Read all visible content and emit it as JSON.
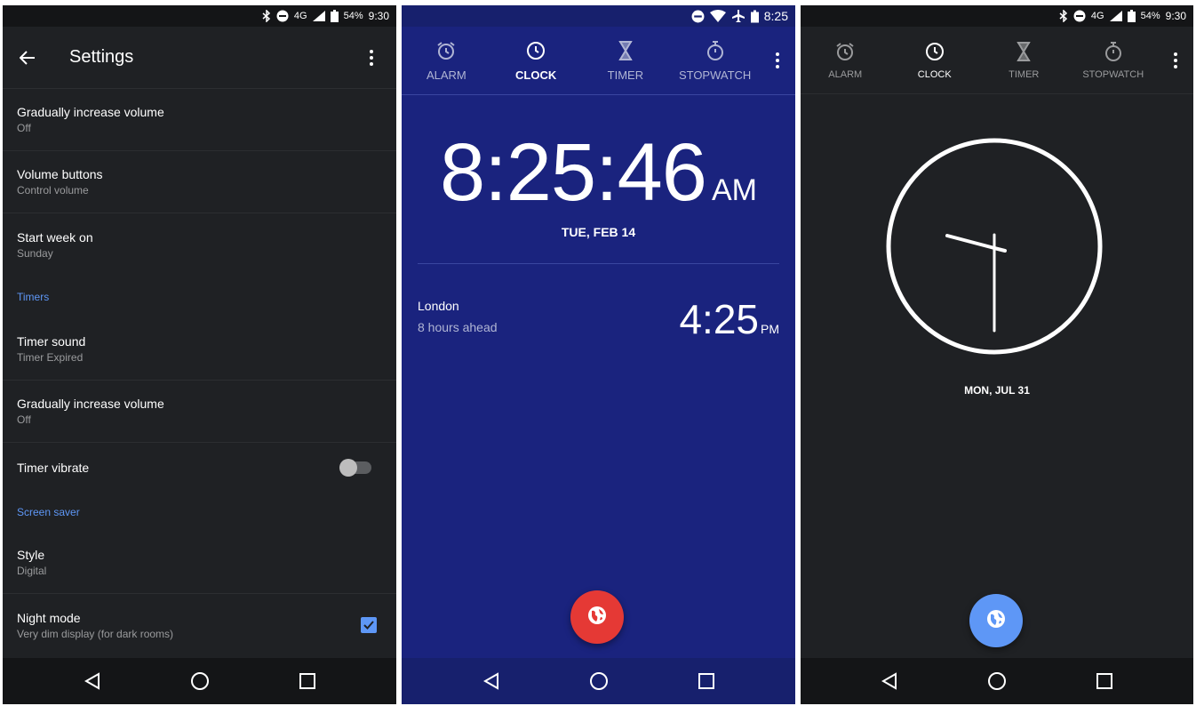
{
  "phone1": {
    "status": {
      "battery": "54%",
      "time": "9:30",
      "network": "4G"
    },
    "appbar": {
      "title": "Settings"
    },
    "items": [
      {
        "primary": "Gradually increase volume",
        "secondary": "Off"
      },
      {
        "primary": "Volume buttons",
        "secondary": "Control volume"
      },
      {
        "primary": "Start week on",
        "secondary": "Sunday"
      }
    ],
    "section_timers": "Timers",
    "timer_items": [
      {
        "primary": "Timer sound",
        "secondary": "Timer Expired"
      },
      {
        "primary": "Gradually increase volume",
        "secondary": "Off"
      }
    ],
    "timer_vibrate": {
      "label": "Timer vibrate",
      "checked": false
    },
    "section_screensaver": "Screen saver",
    "style": {
      "primary": "Style",
      "secondary": "Digital"
    },
    "night_mode": {
      "primary": "Night mode",
      "secondary": "Very dim display (for dark rooms)",
      "checked": true
    }
  },
  "phone2": {
    "status": {
      "time": "8:25"
    },
    "tabs": [
      {
        "label": "ALARM",
        "icon": "alarm-icon"
      },
      {
        "label": "CLOCK",
        "icon": "clock-icon",
        "active": true
      },
      {
        "label": "TIMER",
        "icon": "hourglass-icon"
      },
      {
        "label": "STOPWATCH",
        "icon": "stopwatch-icon"
      }
    ],
    "time": "8:25:46",
    "ampm": "AM",
    "date": "TUE, FEB 14",
    "city": {
      "name": "London",
      "offset": "8 hours ahead",
      "time": "4:25",
      "ampm": "PM"
    },
    "accent": "#1a237e",
    "fab_color": "#e53935"
  },
  "phone3": {
    "status": {
      "battery": "54%",
      "time": "9:30",
      "network": "4G"
    },
    "tabs": [
      {
        "label": "ALARM",
        "icon": "alarm-icon"
      },
      {
        "label": "CLOCK",
        "icon": "clock-icon",
        "active": true
      },
      {
        "label": "TIMER",
        "icon": "hourglass-icon"
      },
      {
        "label": "STOPWATCH",
        "icon": "stopwatch-icon"
      }
    ],
    "analog_time": "9:30",
    "date": "MON, JUL 31",
    "fab_color": "#5e97f6"
  }
}
